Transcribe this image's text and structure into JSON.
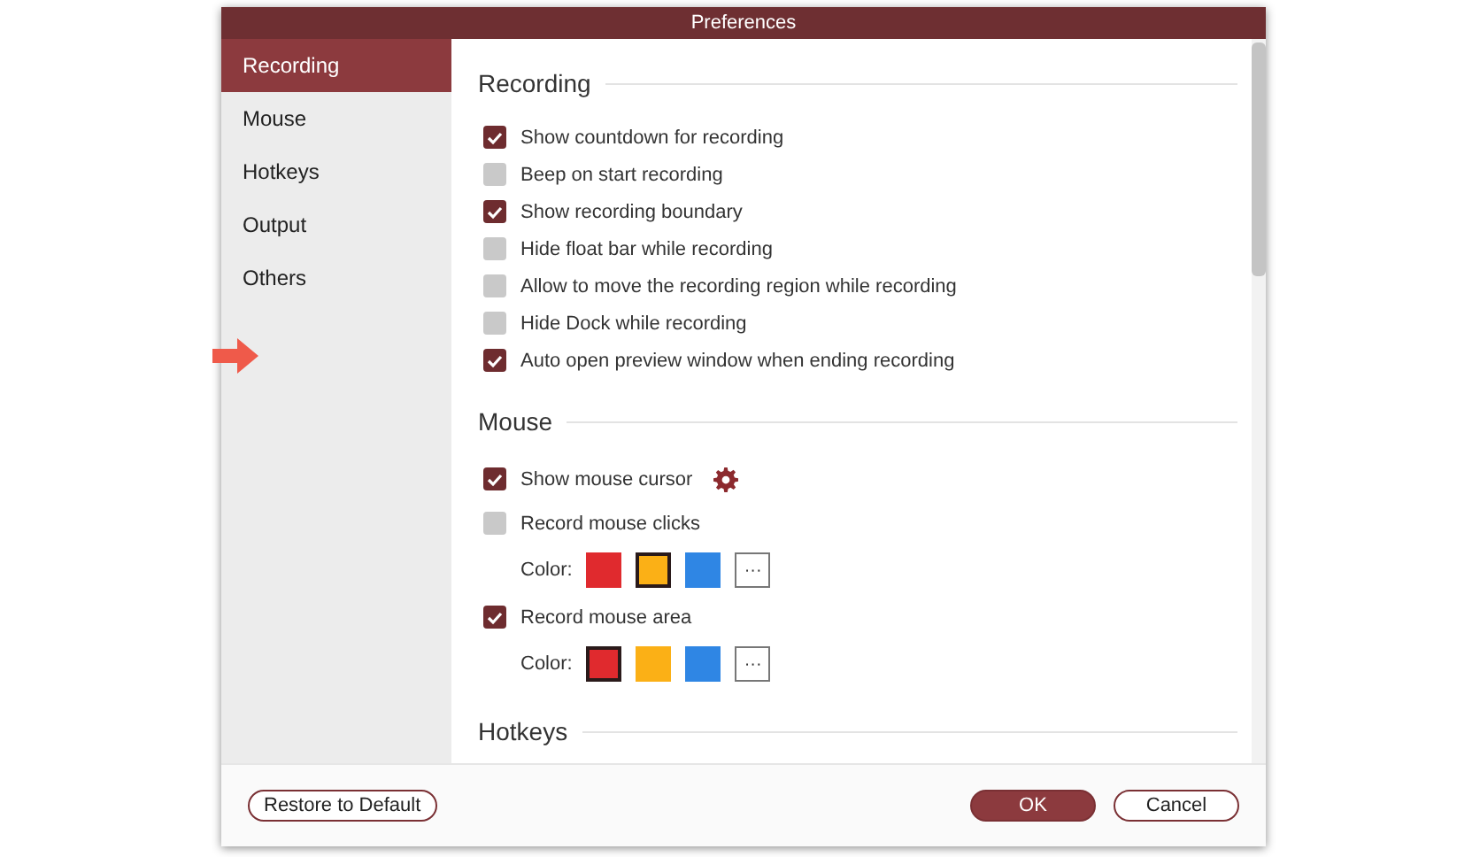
{
  "window": {
    "title": "Preferences"
  },
  "sidebar": {
    "items": [
      {
        "label": "Recording",
        "selected": true
      },
      {
        "label": "Mouse",
        "selected": false
      },
      {
        "label": "Hotkeys",
        "selected": false
      },
      {
        "label": "Output",
        "selected": false
      },
      {
        "label": "Others",
        "selected": false
      }
    ]
  },
  "sections": [
    {
      "title": "Recording",
      "rows": [
        {
          "kind": "checkbox",
          "label": "Show countdown for recording",
          "checked": true
        },
        {
          "kind": "checkbox",
          "label": "Beep on start recording",
          "checked": false
        },
        {
          "kind": "checkbox",
          "label": "Show recording boundary",
          "checked": true
        },
        {
          "kind": "checkbox",
          "label": "Hide float bar while recording",
          "checked": false
        },
        {
          "kind": "checkbox",
          "label": "Allow to move the recording region while recording",
          "checked": false
        },
        {
          "kind": "checkbox",
          "label": "Hide Dock while recording",
          "checked": false
        },
        {
          "kind": "checkbox",
          "label": "Auto open preview window when ending recording",
          "checked": true
        }
      ]
    },
    {
      "title": "Mouse",
      "rows": [
        {
          "kind": "checkbox",
          "label": "Show mouse cursor",
          "checked": true,
          "gear": true
        },
        {
          "kind": "checkbox",
          "label": "Record mouse clicks",
          "checked": false
        },
        {
          "kind": "colors",
          "label": "Color:",
          "more": "···",
          "swatches": [
            {
              "color": "#e02a2e",
              "selected": false
            },
            {
              "color": "#fbb016",
              "selected": true
            },
            {
              "color": "#2f86e4",
              "selected": false
            }
          ]
        },
        {
          "kind": "checkbox",
          "label": "Record mouse area",
          "checked": true
        },
        {
          "kind": "colors",
          "label": "Color:",
          "more": "···",
          "swatches": [
            {
              "color": "#e02a2e",
              "selected": true
            },
            {
              "color": "#fbb016",
              "selected": false
            },
            {
              "color": "#2f86e4",
              "selected": false
            }
          ]
        }
      ]
    },
    {
      "title": "Hotkeys"
    }
  ],
  "footer": {
    "buttons": [
      {
        "label": "Restore to Default",
        "kind": "secondary"
      },
      {
        "label": "OK",
        "kind": "primary"
      },
      {
        "label": "Cancel",
        "kind": "secondary"
      }
    ]
  }
}
